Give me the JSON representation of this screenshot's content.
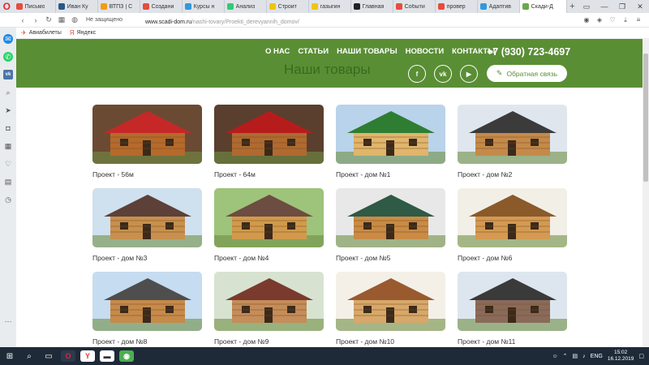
{
  "browser": {
    "tabs": [
      {
        "label": "Письмо",
        "color": "#e74c3c"
      },
      {
        "label": "Иван Ку",
        "color": "#2a5885"
      },
      {
        "label": "ВТПЗ | С",
        "color": "#f39c12"
      },
      {
        "label": "Создани",
        "color": "#e74c3c"
      },
      {
        "label": "Курсы н",
        "color": "#3498db"
      },
      {
        "label": "Анализ",
        "color": "#2ecc71"
      },
      {
        "label": "Строит",
        "color": "#f1c40f"
      },
      {
        "label": "газыгин",
        "color": "#f1c40f"
      },
      {
        "label": "Главная",
        "color": "#222222"
      },
      {
        "label": "Событи",
        "color": "#e74c3c"
      },
      {
        "label": "провер",
        "color": "#e74c3c"
      },
      {
        "label": "Адаптив",
        "color": "#3498db"
      },
      {
        "label": "Скади-Д",
        "color": "#6aa84f"
      }
    ],
    "new_tab": "+",
    "secure_label": "Не защищено",
    "url_domain": "www.scadi-dom.ru",
    "url_path": "/nashi-tovary/Proekti_derevyannih_domov/",
    "bookmarks": [
      "Авиабилеты",
      "Яндекс"
    ]
  },
  "site": {
    "nav": [
      "О НАС",
      "СТАТЬИ",
      "НАШИ ТОВАРЫ",
      "НОВОСТИ",
      "КОНТАКТЫ"
    ],
    "phone": "+7 (930) 723-4697",
    "page_title": "Наши товары",
    "social": [
      "f",
      "vk",
      "▶"
    ],
    "feedback_label": "Обратная связь",
    "header_color": "#5a8e35"
  },
  "products": [
    {
      "caption": "Проект - 56м",
      "roof": "#c62828",
      "wall": "#b56a2c",
      "bg": "#6b4a33"
    },
    {
      "caption": "Проект - 64м",
      "roof": "#b71c1c",
      "wall": "#b06a30",
      "bg": "#5a3f2e"
    },
    {
      "caption": "Проект - дом №1",
      "roof": "#2e7d32",
      "wall": "#e0b56c",
      "bg": "#b9d3ea"
    },
    {
      "caption": "Проект - дом №2",
      "roof": "#3b3b3b",
      "wall": "#c48a4a",
      "bg": "#dfe6ee"
    },
    {
      "caption": "Проект - дом №3",
      "roof": "#5d4037",
      "wall": "#c8904e",
      "bg": "#cfe0ef"
    },
    {
      "caption": "Проект - дом №4",
      "roof": "#6d4c41",
      "wall": "#d19a4b",
      "bg": "#9ec37a"
    },
    {
      "caption": "Проект - дом №5",
      "roof": "#2f5a45",
      "wall": "#c98b45",
      "bg": "#e8e8e8"
    },
    {
      "caption": "Проект - дом №6",
      "roof": "#8a5a2b",
      "wall": "#d49a52",
      "bg": "#f2efe6"
    },
    {
      "caption": "Проект - дом №8",
      "roof": "#4e4e4e",
      "wall": "#c68a4a",
      "bg": "#c6dcf0"
    },
    {
      "caption": "Проект - дом №9",
      "roof": "#7a3b2e",
      "wall": "#c48d5a",
      "bg": "#d7e3d0"
    },
    {
      "caption": "Проект - дом №10",
      "roof": "#9a5a30",
      "wall": "#d7a86a",
      "bg": "#f4f0e8"
    },
    {
      "caption": "Проект - дом №11",
      "roof": "#3a3a3a",
      "wall": "#8a6a5a",
      "bg": "#dde6ee"
    }
  ],
  "taskbar": {
    "lang": "ENG",
    "time": "15:02",
    "date": "16.12.2019"
  }
}
